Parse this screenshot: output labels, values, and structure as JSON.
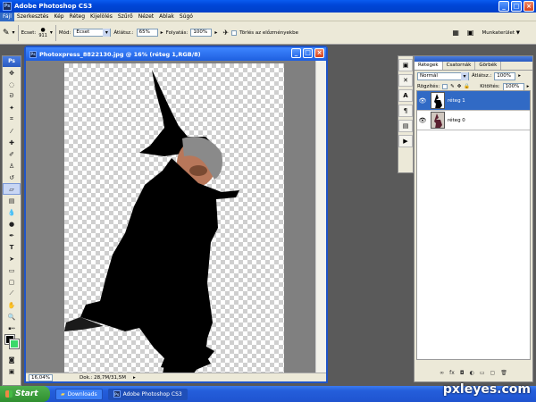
{
  "window": {
    "title": "Adobe Photoshop CS3"
  },
  "menu": [
    "Fájl",
    "Szerkesztés",
    "Kép",
    "Réteg",
    "Kijelölés",
    "Szűrő",
    "Nézet",
    "Ablak",
    "Súgó"
  ],
  "options": {
    "ecset_label": "Ecset:",
    "ecset_size": "911",
    "mod_label": "Mód:",
    "mod_value": "Ecset",
    "atlatszo_label": "Átlátsz.:",
    "atlatszo_value": "65%",
    "folyatas_label": "Folyatás:",
    "folyatas_value": "100%",
    "torles_label": "Törlés az előzményekbe",
    "munkaterulet": "Munkaterület ▼"
  },
  "toolbox": {
    "header": "Ps"
  },
  "document": {
    "title": "Photoxpress_8822130.jpg @ 16% (réteg 1,RGB/8)",
    "zoom": "16,04%",
    "doc_info": "Dok.: 28,7M/31,5M"
  },
  "layers_panel": {
    "tabs": [
      "Rétegek",
      "Csatornák",
      "Görbék"
    ],
    "blend_mode": "Normál",
    "opacity_label": "Átlátsz.:",
    "opacity_value": "100%",
    "lock_label": "Rögzítés:",
    "fill_label": "Kitöltés:",
    "fill_value": "100%",
    "layers": [
      {
        "name": "réteg 1",
        "selected": true
      },
      {
        "name": "réteg 0",
        "selected": false
      }
    ]
  },
  "taskbar": {
    "start": "Start",
    "items": [
      "Downloads",
      "Adobe Photoshop CS3"
    ]
  },
  "watermark": "pxleyes.com"
}
